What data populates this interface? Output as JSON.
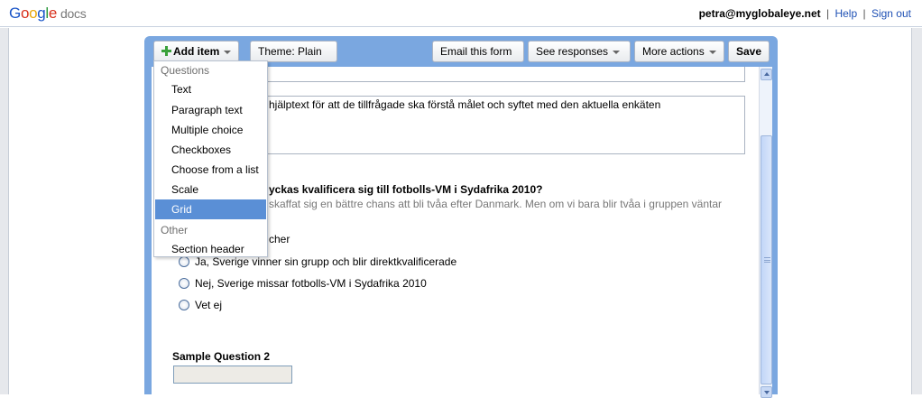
{
  "header": {
    "logo_google": "Google",
    "logo_docs": "docs",
    "user_email": "petra@myglobaleye.net",
    "help_link": "Help",
    "signout_link": "Sign out",
    "separator": "|"
  },
  "toolbar": {
    "add_item": "Add item",
    "theme": "Theme:  Plain",
    "email_form": "Email this form",
    "see_responses": "See responses",
    "more_actions": "More actions",
    "save": "Save"
  },
  "menu": {
    "group_questions": "Questions",
    "items_questions": [
      "Text",
      "Paragraph text",
      "Multiple choice",
      "Checkboxes",
      "Choose from a list",
      "Scale",
      "Grid"
    ],
    "group_other": "Other",
    "items_other": [
      "Section header"
    ],
    "active_item": "Grid"
  },
  "form": {
    "description_partial": "hjälptext för att de tillfrågade ska förstå målet och syftet med den aktuella enkäten",
    "question_title_partial": "yckas kvalificera sig till fotbolls-VM i Sydafrika 2010?",
    "question_help_partial": "skaffat sig en bättre chans att bli tvåa efter Danmark. Men om vi bara blir tvåa i gruppen väntar",
    "option_partial": "cher",
    "options": [
      "Ja, Sverige vinner sin grupp och blir direktkvalificerade",
      "Nej, Sverige missar fotbolls-VM i Sydafrika 2010",
      "Vet ej"
    ],
    "question2_title": "Sample Question 2"
  }
}
